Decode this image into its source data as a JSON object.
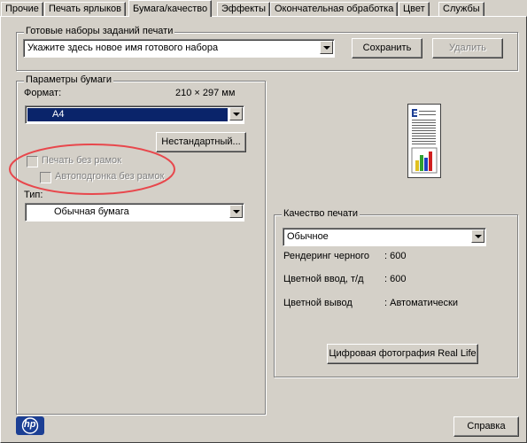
{
  "tabs": [
    "Прочие",
    "Печать ярлыков",
    "Бумага/качество",
    "Эффекты",
    "Окончательная обработка",
    "Цвет",
    "Службы"
  ],
  "active_tab": "Бумага/качество",
  "presets": {
    "title": "Готовые наборы заданий печати",
    "combo_value": "Укажите здесь новое имя готового набора",
    "save_label": "Сохранить",
    "delete_label": "Удалить"
  },
  "paper": {
    "title": "Параметры бумаги",
    "format_label": "Формат:",
    "size_text": "210 × 297 мм",
    "format_value": "A4",
    "custom_button": "Нестандартный...",
    "borderless_print": "Печать без рамок",
    "borderless_autofit": "Автоподгонка без рамок",
    "type_label": "Тип:",
    "type_value": "Обычная бумага"
  },
  "quality": {
    "title": "Качество печати",
    "value": "Обычное",
    "rows": [
      {
        "label": "Рендеринг черного",
        "value": ": 600"
      },
      {
        "label": "Цветной ввод, т/д",
        "value": ": 600"
      },
      {
        "label": "Цветной вывод",
        "value": ": Автоматически"
      }
    ],
    "reallife_button": "Цифровая фотография Real Life"
  },
  "footer": {
    "logo_text": "hp",
    "help_button": "Справка"
  },
  "colors": {
    "dialog_bg": "#d4d0c8",
    "selection": "#0a246a",
    "annotation_ellipse": "#e8474c",
    "hp_blue": "#1c3f94"
  }
}
